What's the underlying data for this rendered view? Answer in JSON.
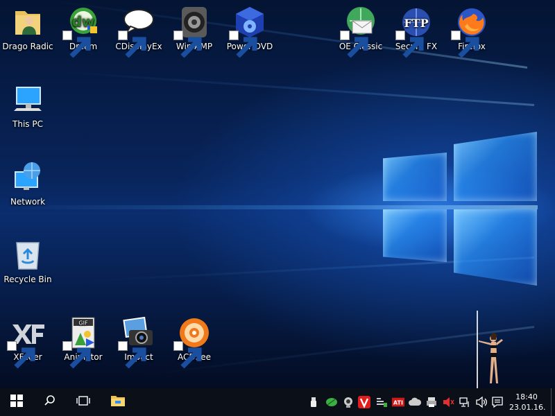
{
  "desktop": {
    "icons": [
      {
        "label": "Drago Radic",
        "icon": "user-folder-icon"
      },
      {
        "label": "Dream",
        "icon": "dreamweaver-icon"
      },
      {
        "label": "CDisplayEx",
        "icon": "speech-bubble-icon"
      },
      {
        "label": "Win AMP",
        "icon": "speaker-icon"
      },
      {
        "label": "Power DVD",
        "icon": "dvd-cube-icon"
      },
      {
        "label": "OE Classic",
        "icon": "mail-globe-icon"
      },
      {
        "label": "Secure FX",
        "icon": "ftp-globe-icon"
      },
      {
        "label": "Firefox",
        "icon": "firefox-icon"
      },
      {
        "label": "This PC",
        "icon": "computer-icon"
      },
      {
        "label": "Network",
        "icon": "network-globe-icon"
      },
      {
        "label": "Recycle Bin",
        "icon": "recycle-bin-icon"
      },
      {
        "label": "XFader",
        "icon": "xf-logo-icon"
      },
      {
        "label": "Animator",
        "icon": "gif-animator-icon"
      },
      {
        "label": "Impact",
        "icon": "camera-icon"
      },
      {
        "label": "ACDSee",
        "icon": "acdsee-icon"
      }
    ]
  },
  "taskbar": {
    "start_icon": "windows-start-icon",
    "search_icon": "search-icon",
    "task_view_icon": "task-view-icon",
    "explorer_icon": "file-explorer-icon",
    "tray_icons": [
      "usb-icon",
      "leaf-icon",
      "webcam-icon",
      "vivaldi-icon",
      "network-adapter-icon",
      "ati-icon",
      "cloud-icon",
      "printer-icon",
      "speaker-muted-red-icon",
      "network-icon",
      "volume-icon",
      "action-center-icon"
    ],
    "ati_text": "ATI",
    "clock": {
      "time": "18:40",
      "date": "23.01.16."
    }
  },
  "colors": {
    "taskbar_bg": "#0b0f18",
    "desktop_accent": "#1e78ff"
  }
}
